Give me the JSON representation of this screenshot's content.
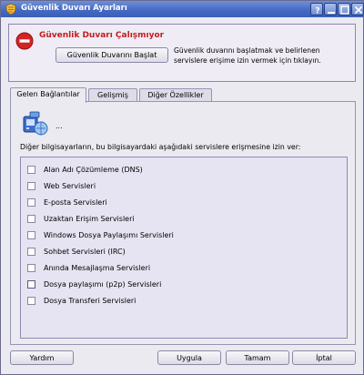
{
  "window": {
    "title": "Güvenlik Duvarı Ayarları",
    "accent": "#4368c2"
  },
  "status": {
    "title": "Güvenlik Duvarı Çalışmıyor",
    "title_color": "#c21e1e",
    "start_button": "Güvenlik Duvarını Başlat",
    "description": "Güvenlik duvarını başlatmak ve belirlenen servislere erişime izin vermek için tıklayın."
  },
  "tabs": [
    {
      "label": "Gelen Bağlantılar",
      "active": true
    },
    {
      "label": "Gelişmiş",
      "active": false
    },
    {
      "label": "Diğer Özellikler",
      "active": false
    }
  ],
  "incoming": {
    "ellipsis": "...",
    "allow_text": "Diğer bilgisayarların, bu bilgisayardaki aşağıdaki servislere erişmesine izin ver:",
    "services": [
      {
        "label": "Alan Adı Çözümleme (DNS)",
        "checked": false
      },
      {
        "label": "Web Servisleri",
        "checked": false
      },
      {
        "label": "E-posta Servisleri",
        "checked": false
      },
      {
        "label": "Uzaktan Erişim Servisleri",
        "checked": false
      },
      {
        "label": "Windows Dosya Paylaşımı Servisleri",
        "checked": false
      },
      {
        "label": "Sohbet Servisleri (IRC)",
        "checked": false
      },
      {
        "label": "Anında Mesajlaşma Servisleri",
        "checked": false
      },
      {
        "label": "Dosya paylaşımı (p2p) Servisleri",
        "checked": false
      },
      {
        "label": "Dosya Transferi Servisleri",
        "checked": false
      }
    ]
  },
  "buttons": {
    "help": "Yardım",
    "apply": "Uygula",
    "ok": "Tamam",
    "cancel": "İptal"
  }
}
